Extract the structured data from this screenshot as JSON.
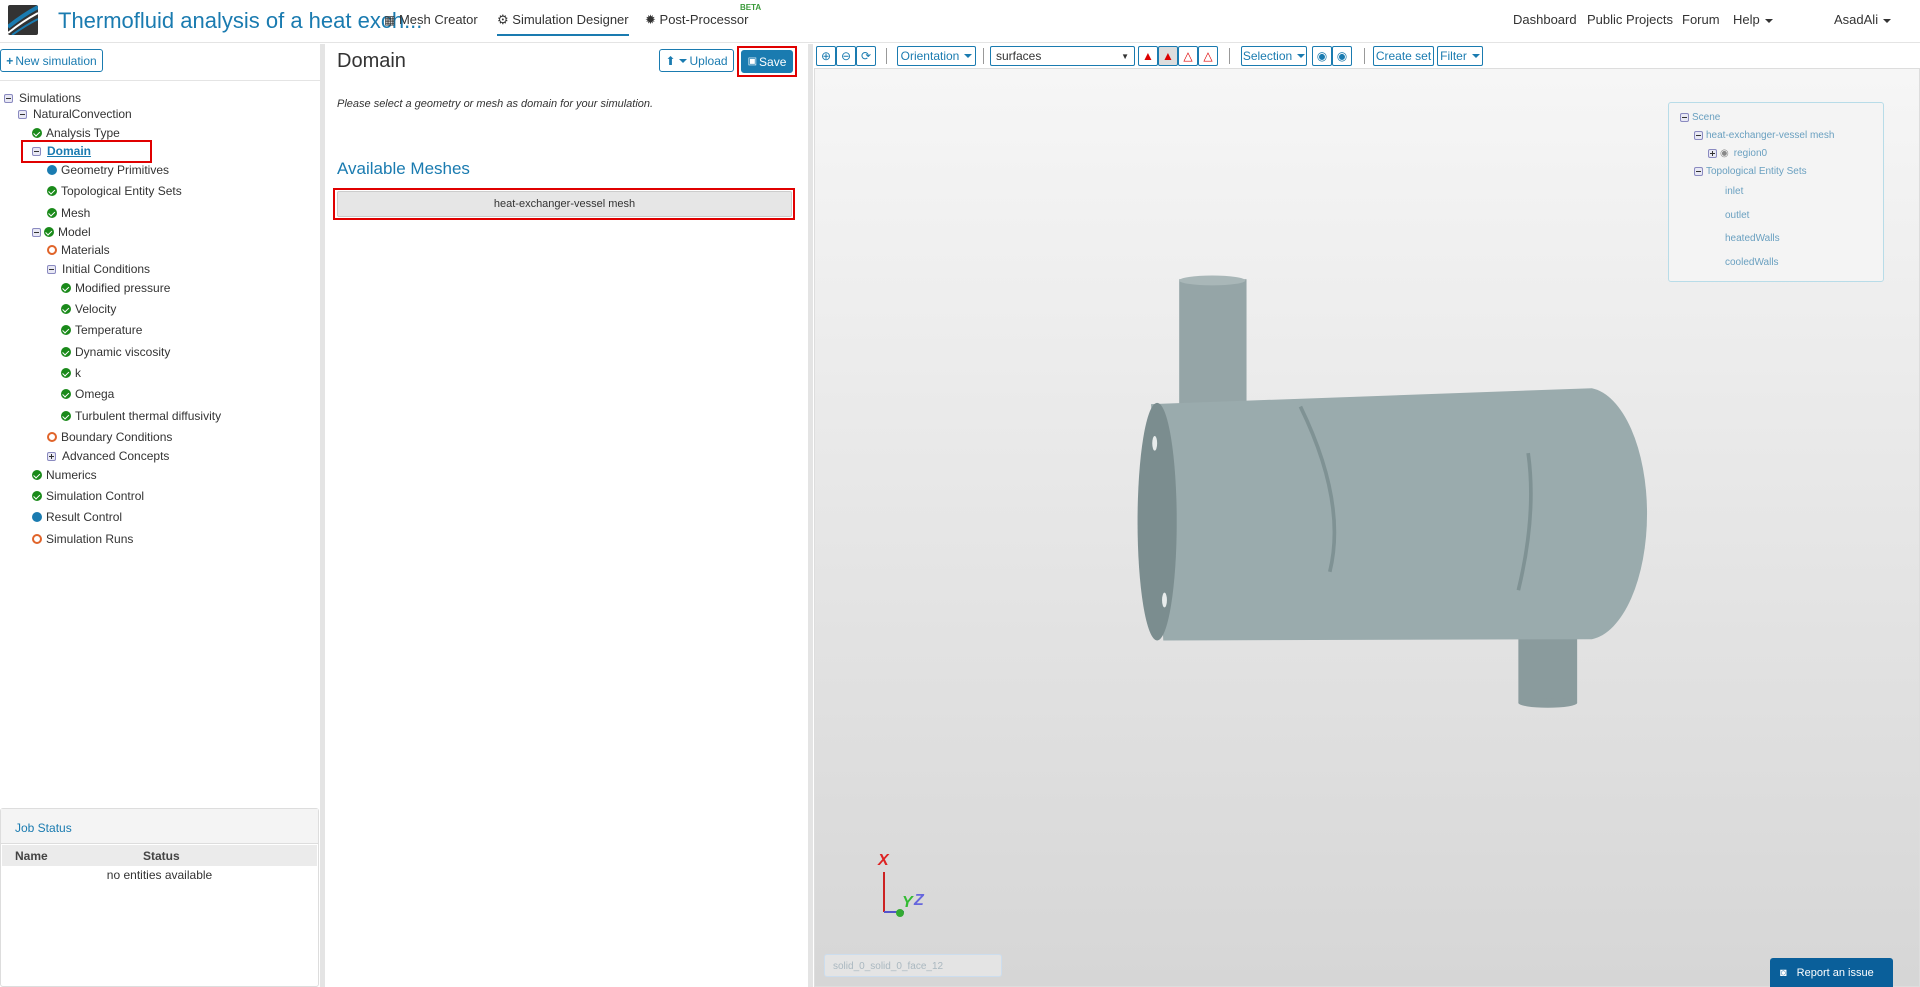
{
  "header": {
    "title": "Thermofluid analysis of a heat exch...",
    "nav": [
      {
        "label": "Mesh Creator",
        "icon": "grid-icon"
      },
      {
        "label": "Simulation Designer",
        "icon": "gears-icon"
      },
      {
        "label": "Post-Processor",
        "icon": "cog-icon",
        "badge": "BETA"
      }
    ],
    "right": {
      "dashboard": "Dashboard",
      "public_projects": "Public Projects",
      "forum": "Forum",
      "help": "Help",
      "user": "AsadAli"
    }
  },
  "left": {
    "new_simulation": "New simulation",
    "tree": {
      "root": "Simulations",
      "simulation": "NaturalConvection",
      "analysis_type": "Analysis Type",
      "domain": "Domain",
      "geometry_primitives": "Geometry Primitives",
      "topological_entity_sets": "Topological Entity Sets",
      "mesh": "Mesh",
      "model": "Model",
      "materials": "Materials",
      "initial_conditions": "Initial Conditions",
      "ic_items": [
        "Modified pressure",
        "Velocity",
        "Temperature",
        "Dynamic viscosity",
        "k",
        "Omega",
        "Turbulent thermal diffusivity"
      ],
      "boundary_conditions": "Boundary Conditions",
      "advanced_concepts": "Advanced Concepts",
      "numerics": "Numerics",
      "simulation_control": "Simulation Control",
      "result_control": "Result Control",
      "simulation_runs": "Simulation Runs"
    },
    "job_status": {
      "title": "Job Status",
      "columns": [
        "Name",
        "Status"
      ],
      "empty": "no entities available"
    }
  },
  "middle": {
    "title": "Domain",
    "upload": "Upload",
    "save": "Save",
    "instructions": "Please select a geometry or mesh as domain for your simulation.",
    "available_meshes": "Available Meshes",
    "meshes": [
      "heat-exchanger-vessel mesh"
    ]
  },
  "viewer": {
    "toolbar": {
      "orientation": "Orientation",
      "render_mode": "surfaces",
      "selection": "Selection",
      "create_set": "Create set",
      "filter": "Filter"
    },
    "scene": {
      "root": "Scene",
      "mesh": "heat-exchanger-vessel mesh",
      "region": "region0",
      "sets_label": "Topological Entity Sets",
      "sets": [
        "inlet",
        "outlet",
        "heatedWalls",
        "cooledWalls"
      ]
    },
    "axes": {
      "x": "X",
      "y": "Y",
      "z": "Z"
    },
    "selected_face": "solid_0_solid_0_face_12"
  },
  "report_issue": "Report an issue",
  "colors": {
    "accent": "#1a7bb0",
    "success": "#1a8a1a",
    "warning": "#e0642a",
    "highlight": "#e00000"
  }
}
